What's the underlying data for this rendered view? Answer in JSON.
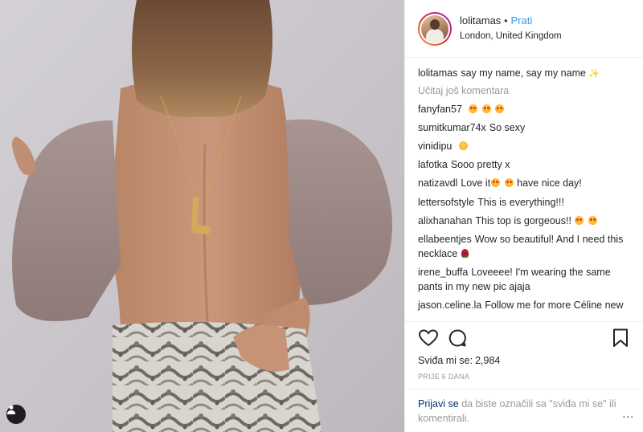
{
  "post": {
    "photo_alt": "",
    "tag_icon": "user-tag-icon"
  },
  "header": {
    "username": "lolitamas",
    "separator": "•",
    "follow_label": "Prati",
    "location": "London, United Kingdom"
  },
  "caption": {
    "username": "lolitamas",
    "text": "say my name, say my name",
    "emoji": "✨"
  },
  "load_more": "Učitaj još komentara",
  "comments": [
    {
      "user": "fanyfan57",
      "text": "",
      "emojis": [
        "love",
        "love",
        "love"
      ]
    },
    {
      "user": "sumitkumar74x",
      "text": "So sexy",
      "emojis": []
    },
    {
      "user": "vinidipu",
      "text": "",
      "emojis": [
        "kiss"
      ]
    },
    {
      "user": "lafotka",
      "text": "Sooo pretty x",
      "emojis": []
    },
    {
      "user": "natizavdl",
      "text": "Love it",
      "text2": " have nice day!",
      "emojis": [
        "love",
        "love"
      ]
    },
    {
      "user": "lettersofstyle",
      "text": "This is everything!!!",
      "emojis": []
    },
    {
      "user": "alixhanahan",
      "text": "This top is gorgeous!!",
      "emojis": [
        "love",
        "love"
      ]
    },
    {
      "user": "ellabeentjes",
      "text": "Wow so beautiful! And I need this necklace",
      "emojis": [
        "rose"
      ]
    },
    {
      "user": "irene_buffa",
      "text": "Loveeee! I'm wearing the same pants in my new pic ajaja",
      "emojis": []
    },
    {
      "user": "jason.celine.la",
      "text": "Follow me for more Céline new arrivals and looks!",
      "emojis": []
    }
  ],
  "actions": {
    "like_icon": "heart-icon",
    "comment_icon": "comment-icon",
    "save_icon": "bookmark-icon",
    "likes_label": "Sviđa mi se:",
    "likes_count": "2,984",
    "age": "PRIJE 6 DANA"
  },
  "login_prompt": {
    "link": "Prijavi se",
    "text": "da biste označili sa \"sviđa mi se\" ili komentirali.",
    "more": "..."
  }
}
